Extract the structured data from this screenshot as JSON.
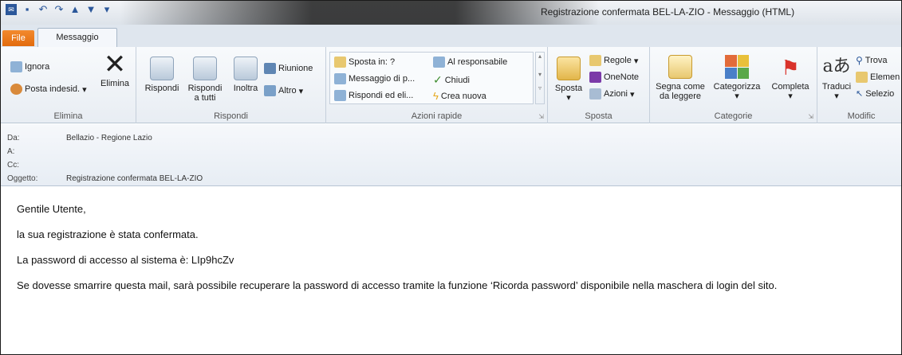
{
  "window": {
    "title": "Registrazione confermata BEL-LA-ZIO  -  Messaggio (HTML)"
  },
  "tabs": {
    "file": "File",
    "message": "Messaggio"
  },
  "ribbon": {
    "elimina_group": {
      "ignora": "Ignora",
      "posta_indesid": "Posta indesid.",
      "elimina": "Elimina",
      "label": "Elimina"
    },
    "rispondi_group": {
      "rispondi": "Rispondi",
      "rispondi_tutti_1": "Rispondi",
      "rispondi_tutti_2": "a tutti",
      "inoltra": "Inoltra",
      "riunione": "Riunione",
      "altro": "Altro",
      "label": "Rispondi"
    },
    "azioni_rapide": {
      "sposta_in": "Sposta in: ?",
      "messaggio_di": "Messaggio di p...",
      "rispondi_ed_eli": "Rispondi ed eli...",
      "al_responsabile": "Al responsabile",
      "chiudi": "Chiudi",
      "crea_nuova": "Crea nuova",
      "label": "Azioni rapide"
    },
    "sposta_group": {
      "sposta": "Sposta",
      "regole": "Regole",
      "onenote": "OneNote",
      "azioni": "Azioni",
      "label": "Sposta"
    },
    "categorie": {
      "segna_1": "Segna come",
      "segna_2": "da leggere",
      "categorizza": "Categorizza",
      "completa": "Completa",
      "label": "Categorie"
    },
    "modifica": {
      "traduci": "Traduci",
      "trova": "Trova",
      "elementi": "Elemen",
      "seleziona": "Selezio",
      "label": "Modific"
    }
  },
  "header": {
    "da_label": "Da:",
    "da_value": "Bellazio - Regione Lazio",
    "a_label": "A:",
    "cc_label": "Cc:",
    "oggetto_label": "Oggetto:",
    "oggetto_value": "Registrazione confermata BEL-LA-ZIO"
  },
  "body": {
    "line1": "Gentile Utente,",
    "line2": "la sua registrazione è stata confermata.",
    "line3": "La password di accesso al sistema è: LIp9hcZv",
    "line4": "Se dovesse smarrire questa mail, sarà possibile recuperare la password di accesso tramite la funzione ‘Ricorda password’ disponibile nella maschera di login del sito."
  },
  "colors": {
    "file_tab": "#e26b0d",
    "ribbon_bg": "#e8edf3",
    "flag": "#d9322b"
  }
}
